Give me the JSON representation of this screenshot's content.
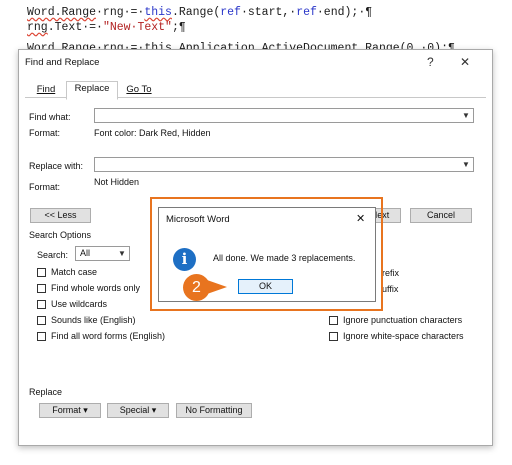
{
  "code": {
    "line1_a": "Word.Range",
    "line1_b": "·rng·=·",
    "line1_c": "this",
    "line1_d": ".Range(",
    "line1_e": "ref",
    "line1_f": "·start,·",
    "line1_g": "ref",
    "line1_h": "·end);·¶",
    "line2_a": "rng",
    "line2_b": ".Text·=·",
    "line2_c": "\"New·Text\"",
    "line2_d": ";¶",
    "line3": "Word.Range·rng·=·this.Application.ActiveDocument.Range(0,·0);¶"
  },
  "dialog": {
    "title": "Find and Replace",
    "help": "?",
    "close": "✕",
    "tabs": [
      {
        "label": "Find"
      },
      {
        "label": "Replace"
      },
      {
        "label": "Go To"
      }
    ],
    "find_what_label": "Find what:",
    "find_format_label": "Format:",
    "find_format_value": "Font color: Dark Red, Hidden",
    "replace_with_label": "Replace with:",
    "replace_format_label": "Format:",
    "replace_format_value": "Not Hidden",
    "less_button": "<< Less",
    "next_button": "Next",
    "cancel_button": "Cancel",
    "search_options_label": "Search Options",
    "search_label": "Search:",
    "search_value": "All",
    "options_left": [
      "Match case",
      "Find whole words only",
      "Use wildcards",
      "Sounds like (English)",
      "Find all word forms (English)"
    ],
    "options_right_partial": [
      "refix",
      "uffix"
    ],
    "options_right": [
      "Ignore punctuation characters",
      "Ignore white-space characters"
    ],
    "replace_section_label": "Replace",
    "format_button": "Format ▾",
    "special_button": "Special ▾",
    "no_formatting_button": "No Formatting"
  },
  "message_box": {
    "title": "Microsoft Word",
    "close": "✕",
    "message": "All done. We made 3 replacements.",
    "ok_button": "OK",
    "icon": "info-icon"
  },
  "callout": {
    "number": "2",
    "color": "#e8741f"
  }
}
